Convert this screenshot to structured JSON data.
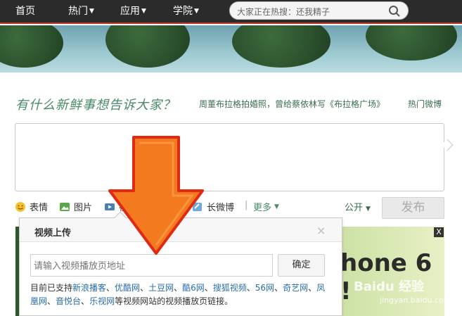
{
  "nav": {
    "home": "首页",
    "hot": "热门",
    "apps": "应用",
    "college": "学院",
    "search_placeholder": "大家正在热搜：还我精子"
  },
  "compose": {
    "prompt": "有什么新鲜事想告诉大家？",
    "hot_topic": "周董布拉格拍婚照，曾给蔡依林写《布拉格广场》",
    "hot_weibo": "热门微博"
  },
  "toolbar": {
    "emoji": "表情",
    "image": "图片",
    "video": "视频",
    "long_weibo": "长微博",
    "separator": "|",
    "more": "更多",
    "visibility": "公开",
    "publish": "发布"
  },
  "popup": {
    "title": "视频上传",
    "close": "×",
    "url_placeholder": "请输入视频播放页地址",
    "confirm": "确定",
    "support_prefix": "目前已支持",
    "sites": [
      "新浪播客",
      "优酷网",
      "土豆网",
      "酷6网",
      "搜狐视频",
      "56网",
      "奇艺网",
      "凤凰网",
      "音悦台",
      "乐视网"
    ],
    "support_suffix": "等视频网站的视频播放页链接。"
  },
  "ad": {
    "text": "hone 6 !",
    "close": "X"
  },
  "watermark": {
    "main": "Baidu 经验",
    "sub": "jingyan.baidu.com"
  },
  "colors": {
    "nav_bg": "#2b2b2b",
    "accent_green": "#4a8a66",
    "link_blue": "#2a6ea8",
    "arrow": "#f47a20"
  }
}
